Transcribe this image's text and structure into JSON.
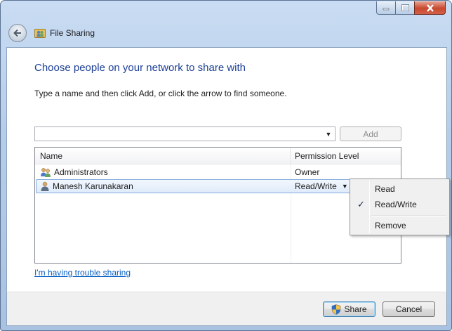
{
  "window": {
    "title": "File Sharing",
    "caption_buttons": [
      "minimize",
      "maximize",
      "close"
    ]
  },
  "content": {
    "heading": "Choose people on your network to share with",
    "instruction": "Type a name and then click Add, or click the arrow to find someone.",
    "name_input": {
      "value": "",
      "placeholder": ""
    },
    "add_button": "Add"
  },
  "list": {
    "columns": [
      "Name",
      "Permission Level"
    ],
    "rows": [
      {
        "name": "Administrators",
        "permission": "Owner",
        "icon": "user-group-icon"
      },
      {
        "name": "Manesh Karunakaran",
        "permission": "Read/Write",
        "icon": "user-icon",
        "selected": true
      }
    ]
  },
  "context_menu": {
    "items": [
      {
        "label": "Read",
        "checked": false
      },
      {
        "label": "Read/Write",
        "checked": true
      },
      {
        "label": "Remove",
        "checked": false
      }
    ],
    "check_glyph": "✓"
  },
  "trouble_link": "I'm having trouble sharing",
  "footer": {
    "share_button": "Share",
    "cancel_button": "Cancel"
  },
  "colors": {
    "heading": "#1c3f95",
    "link": "#0b61c5",
    "selection_border": "#84acdd"
  }
}
